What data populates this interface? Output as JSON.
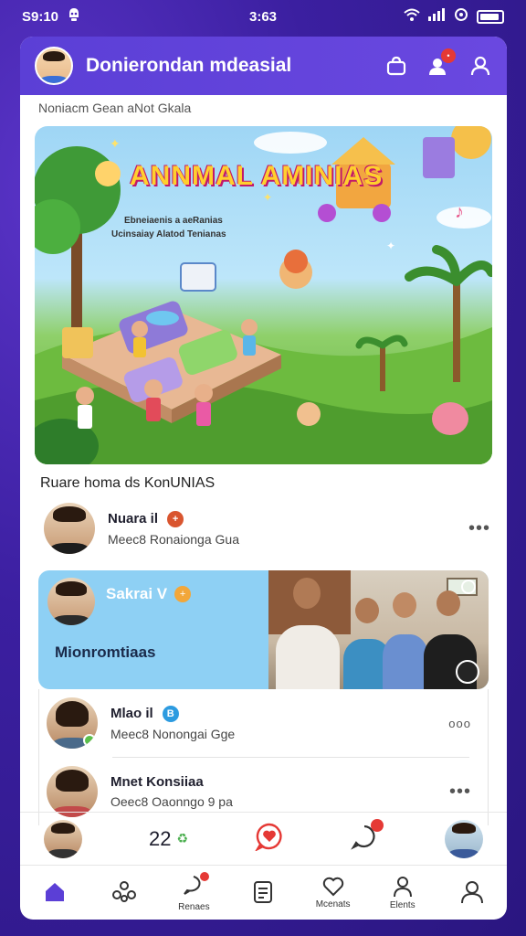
{
  "status_bar": {
    "left_time": "S9:10",
    "center_time": "3:63"
  },
  "header": {
    "title": "Donierondan mdeasial"
  },
  "subtitle": "Noniacm  Gean aNot Gkala",
  "banner": {
    "title": "ANNMAL AMINIAS",
    "line1": "Ebneiaenis a aeRanias",
    "line2": "Ucinsaiay Alatod Tenianas"
  },
  "section_title": "Ruare homa  ds KonUNIAS",
  "feed": [
    {
      "name": "Nuara il",
      "subtitle": "Meec8 Ronaionga Gua",
      "badge_color": "#d9552f",
      "badge_text": "+"
    }
  ],
  "highlight": {
    "name": "Sakrai V",
    "caption": "Mionromtiaas",
    "badge_text": "+"
  },
  "feed_more": [
    {
      "name": "Mlao il",
      "subtitle": "Meec8 Nonongai Gge",
      "badge_text": "B",
      "badge_color": "#2d9be0",
      "more": "ooo"
    },
    {
      "name": "Mnet Konsiiaa",
      "subtitle": "Oeec8 Oaonngo 9 pa",
      "more": "•••"
    }
  ],
  "action_bar": {
    "count": "22"
  },
  "tabs": [
    {
      "id": "home",
      "label": "",
      "icon": "home-icon"
    },
    {
      "id": "friends",
      "label": "",
      "icon": "group-icon"
    },
    {
      "id": "reactions",
      "label": "Renaes",
      "icon": "chat-bubble-icon"
    },
    {
      "id": "notes",
      "label": "",
      "icon": "notes-icon"
    },
    {
      "id": "messages",
      "label": "Mcenats",
      "icon": "heart-chat-icon"
    },
    {
      "id": "clients",
      "label": "Elents",
      "icon": "person-icon"
    },
    {
      "id": "profile",
      "label": "",
      "icon": "profile-icon"
    }
  ],
  "colors": {
    "accent": "#5b3fd6",
    "badge_red": "#e53935",
    "card_blue": "#8ed0f4"
  }
}
